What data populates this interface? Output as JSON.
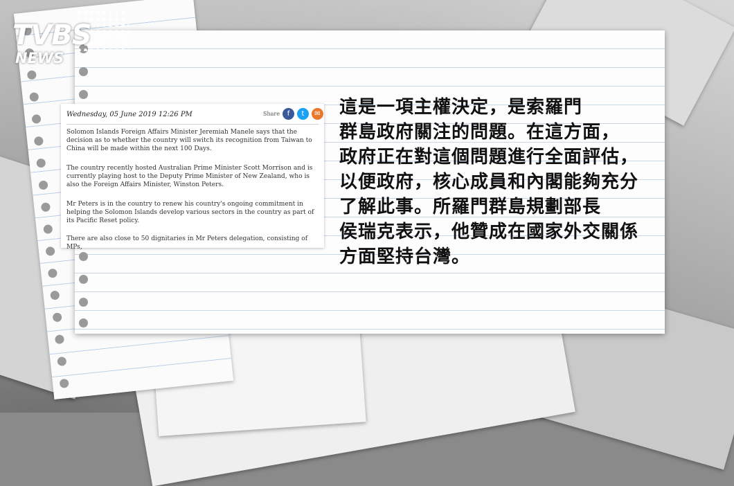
{
  "logo": {
    "main": "TVBS",
    "sub": "NEWS"
  },
  "article": {
    "date": "Wednesday, 05 June 2019 12:26 PM",
    "share_label": "Share",
    "share_icons": [
      "facebook-icon",
      "twitter-icon",
      "email-icon"
    ],
    "paragraphs": [
      "Solomon Islands Foreign Affairs Minister Jeremiah Manele says that the decision as to whether the country will switch its recognition from Taiwan to China will be made within the next 100 Days.",
      "The country recently hosted Australian Prime Minister Scott Morrison and is currently playing host to the Deputy Prime Minister of New Zealand, who is also the Foreign Affairs Minister, Winston Peters.",
      "Mr Peters is in the country to renew his country's ongoing commitment in helping the Solomon Islands develop various sectors in the country as part of its Pacific Reset policy.",
      "There are also close to 50 dignitaries in Mr Peters delegation, consisting of MPs,"
    ]
  },
  "caption": {
    "lines": [
      "這是一項主權決定，是索羅門",
      "群島政府關注的問題。在這方面，",
      "政府正在對這個問題進行全面評估，",
      "以便政府，核心成員和內閣能夠充分",
      "了解此事。所羅門群島規劃部長",
      "侯瑞克表示，他贊成在國家外交關係",
      "方面堅持台灣。"
    ]
  },
  "colors": {
    "facebook": "#3b5998",
    "twitter": "#1da1f2",
    "email": "#e8782c"
  }
}
